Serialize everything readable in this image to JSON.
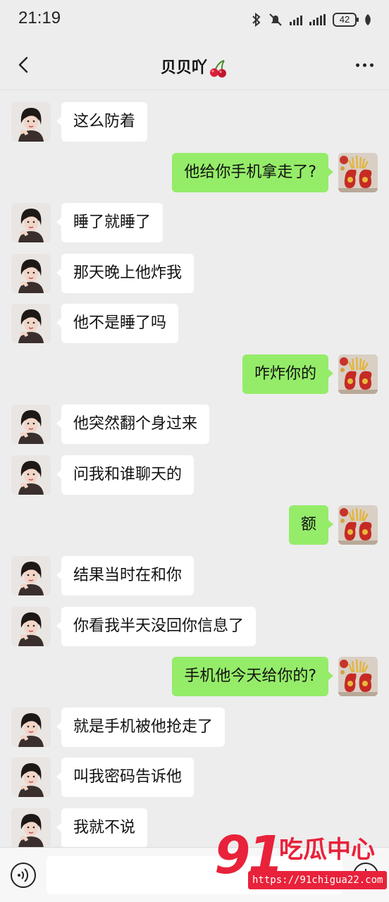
{
  "status_bar": {
    "time": "21:19",
    "battery": "42",
    "icons": [
      "bluetooth-icon",
      "mute-bell-icon",
      "signal-icon",
      "signal-icon",
      "battery-icon",
      "leaf-icon"
    ]
  },
  "nav": {
    "title": "贝贝吖",
    "title_emoji": "cherry-icon",
    "back": "back-icon",
    "more": "more-icon"
  },
  "colors": {
    "background": "#ededed",
    "outgoing_bubble": "#95ec69",
    "incoming_bubble": "#ffffff",
    "watermark": "#e8223a"
  },
  "messages": [
    {
      "side": "in",
      "text": "这么防着"
    },
    {
      "side": "out",
      "text": "他给你手机拿走了?"
    },
    {
      "side": "in",
      "text": "睡了就睡了"
    },
    {
      "side": "in",
      "text": "那天晚上他炸我"
    },
    {
      "side": "in",
      "text": "他不是睡了吗"
    },
    {
      "side": "out",
      "text": "咋炸你的"
    },
    {
      "side": "in",
      "text": "他突然翻个身过来"
    },
    {
      "side": "in",
      "text": "问我和谁聊天的"
    },
    {
      "side": "out",
      "text": "额"
    },
    {
      "side": "in",
      "text": "结果当时在和你"
    },
    {
      "side": "in",
      "text": "你看我半天没回你信息了"
    },
    {
      "side": "out",
      "text": "手机他今天给你的?"
    },
    {
      "side": "in",
      "text": "就是手机被他抢走了"
    },
    {
      "side": "in",
      "text": "叫我密码告诉他"
    },
    {
      "side": "in",
      "text": "我就不说"
    }
  ],
  "input_bar": {
    "voice": "voice-icon",
    "input_value": "",
    "plus": "plus-icon"
  },
  "watermark": {
    "number": "91",
    "text": "吃瓜中心",
    "url": "https://91chigua22.com"
  }
}
